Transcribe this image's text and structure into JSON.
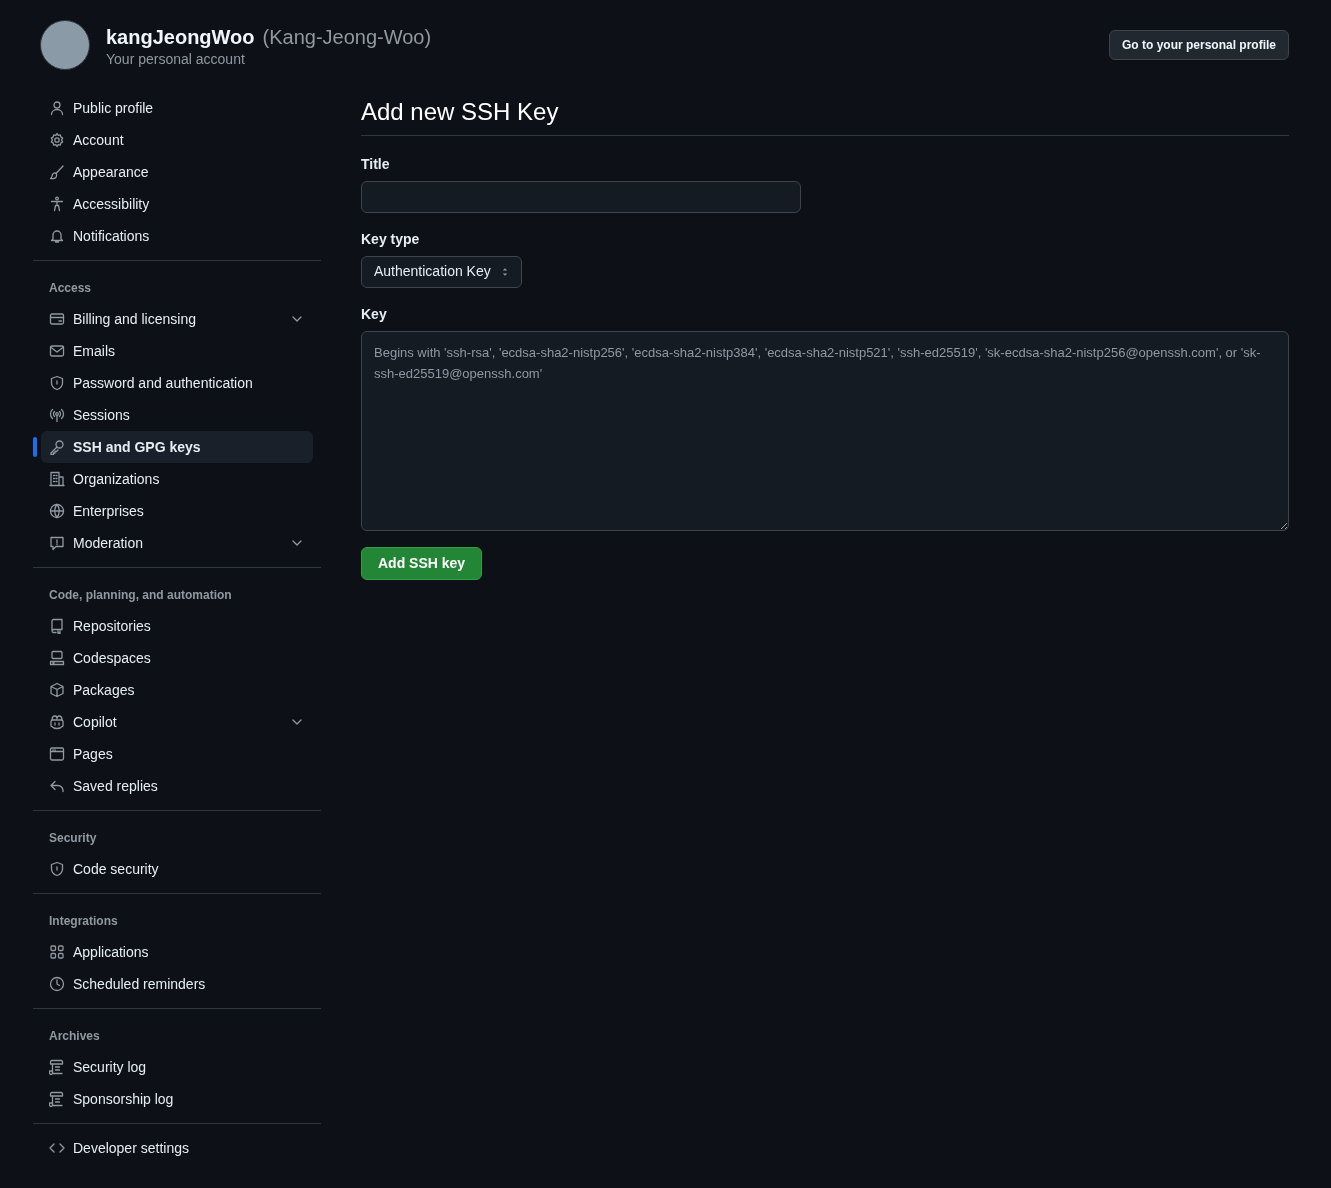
{
  "account": {
    "name": "kangJeongWoo",
    "login": "(Kang-Jeong-Woo)",
    "subtitle": "Your personal account"
  },
  "profile_button": "Go to your personal profile",
  "sidebar": [
    {
      "items": [
        {
          "label": "Public profile",
          "selected": false,
          "expandable": false
        },
        {
          "label": "Account",
          "selected": false,
          "expandable": false
        },
        {
          "label": "Appearance",
          "selected": false,
          "expandable": false
        },
        {
          "label": "Accessibility",
          "selected": false,
          "expandable": false
        },
        {
          "label": "Notifications",
          "selected": false,
          "expandable": false
        }
      ]
    },
    {
      "heading": "Access",
      "items": [
        {
          "label": "Billing and licensing",
          "selected": false,
          "expandable": true
        },
        {
          "label": "Emails",
          "selected": false,
          "expandable": false
        },
        {
          "label": "Password and authentication",
          "selected": false,
          "expandable": false
        },
        {
          "label": "Sessions",
          "selected": false,
          "expandable": false
        },
        {
          "label": "SSH and GPG keys",
          "selected": true,
          "expandable": false
        },
        {
          "label": "Organizations",
          "selected": false,
          "expandable": false
        },
        {
          "label": "Enterprises",
          "selected": false,
          "expandable": false
        },
        {
          "label": "Moderation",
          "selected": false,
          "expandable": true
        }
      ]
    },
    {
      "heading": "Code, planning, and automation",
      "items": [
        {
          "label": "Repositories",
          "selected": false,
          "expandable": false
        },
        {
          "label": "Codespaces",
          "selected": false,
          "expandable": false
        },
        {
          "label": "Packages",
          "selected": false,
          "expandable": false
        },
        {
          "label": "Copilot",
          "selected": false,
          "expandable": true
        },
        {
          "label": "Pages",
          "selected": false,
          "expandable": false
        },
        {
          "label": "Saved replies",
          "selected": false,
          "expandable": false
        }
      ]
    },
    {
      "heading": "Security",
      "items": [
        {
          "label": "Code security",
          "selected": false,
          "expandable": false
        }
      ]
    },
    {
      "heading": "Integrations",
      "items": [
        {
          "label": "Applications",
          "selected": false,
          "expandable": false
        },
        {
          "label": "Scheduled reminders",
          "selected": false,
          "expandable": false
        }
      ]
    },
    {
      "heading": "Archives",
      "items": [
        {
          "label": "Security log",
          "selected": false,
          "expandable": false
        },
        {
          "label": "Sponsorship log",
          "selected": false,
          "expandable": false
        }
      ]
    },
    {
      "items": [
        {
          "label": "Developer settings",
          "selected": false,
          "expandable": false
        }
      ]
    }
  ],
  "form": {
    "title": "Add new SSH Key",
    "title_label": "Title",
    "key_type_label": "Key type",
    "key_type_value": "Authentication Key",
    "key_label": "Key",
    "key_placeholder": "Begins with 'ssh-rsa', 'ecdsa-sha2-nistp256', 'ecdsa-sha2-nistp384', 'ecdsa-sha2-nistp521', 'ssh-ed25519', 'sk-ecdsa-sha2-nistp256@openssh.com', or 'sk-ssh-ed25519@openssh.com'",
    "submit": "Add SSH key"
  }
}
